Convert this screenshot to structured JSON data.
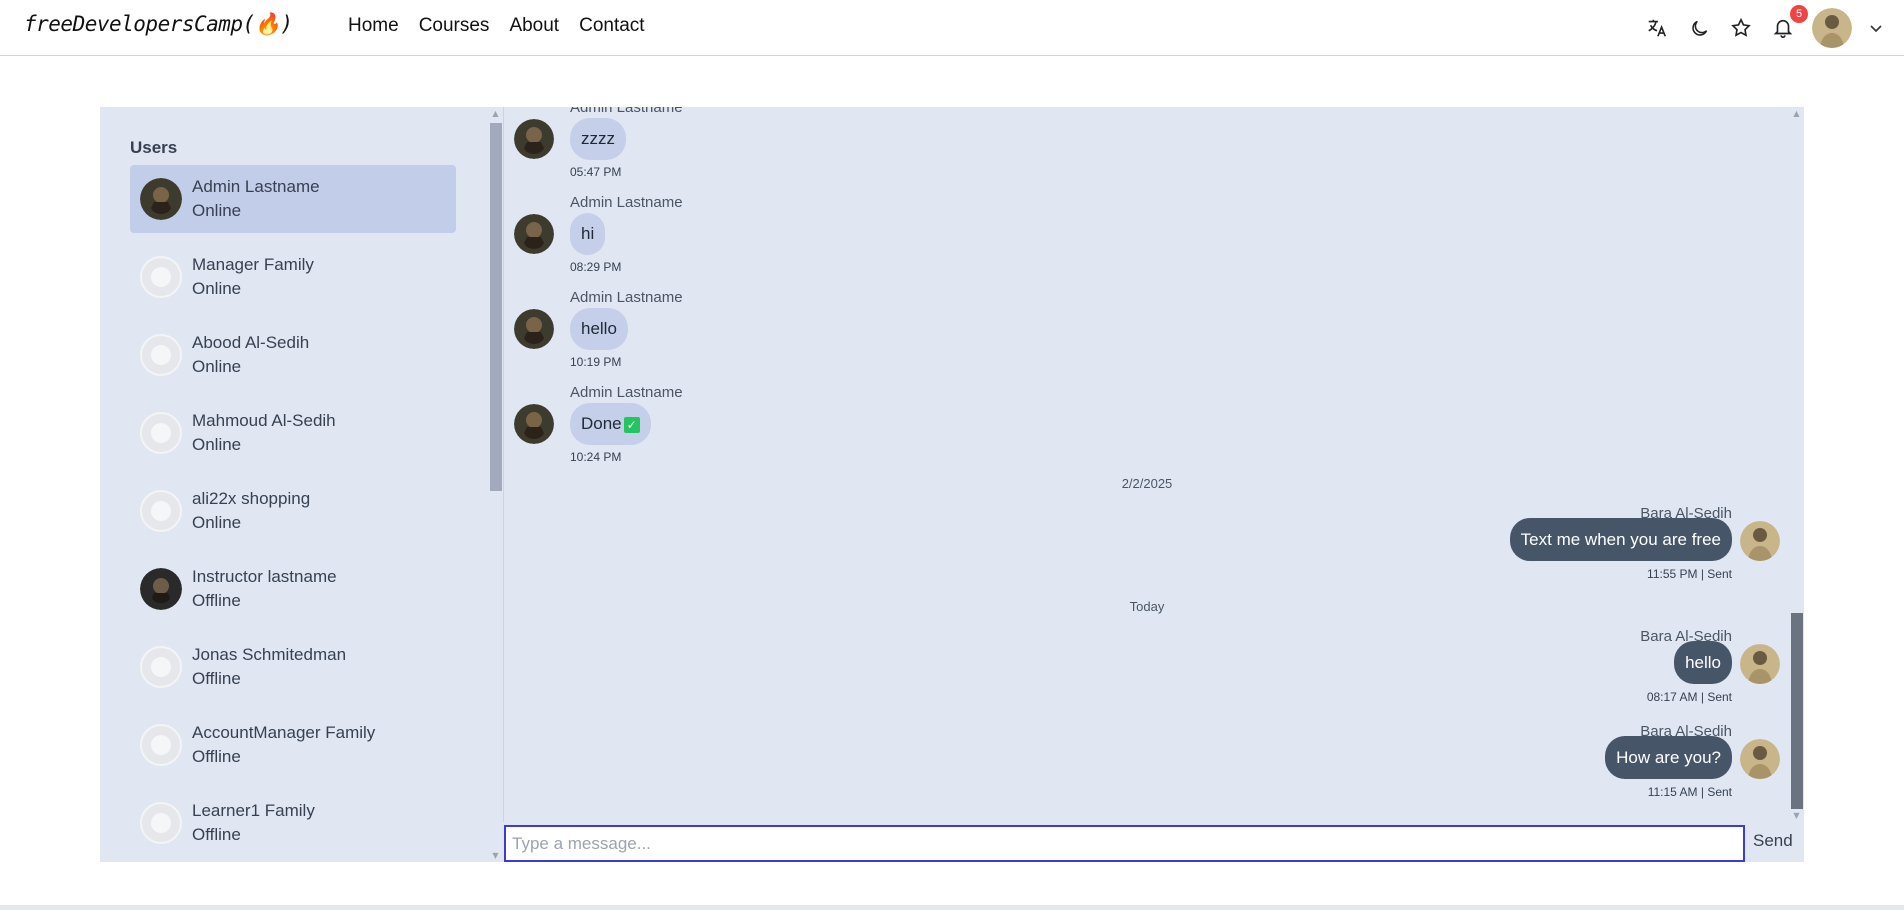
{
  "nav": {
    "logo": "freeDevelopersCamp(🔥)",
    "links": [
      "Home",
      "Courses",
      "About",
      "Contact"
    ],
    "notification_count": "5"
  },
  "sidebar": {
    "title": "Users",
    "users": [
      {
        "name": "Admin Lastname",
        "status": "Online",
        "active": true
      },
      {
        "name": "Manager Family",
        "status": "Online"
      },
      {
        "name": "Abood Al-Sedih",
        "status": "Online"
      },
      {
        "name": "Mahmoud Al-Sedih",
        "status": "Online"
      },
      {
        "name": "ali22x shopping",
        "status": "Online"
      },
      {
        "name": "Instructor lastname",
        "status": "Offline"
      },
      {
        "name": "Jonas Schmitedman",
        "status": "Offline"
      },
      {
        "name": "AccountManager Family",
        "status": "Offline"
      },
      {
        "name": "Learner1 Family",
        "status": "Offline"
      }
    ]
  },
  "messages": {
    "incoming": [
      {
        "sender": "Admin Lastname",
        "text": "zzzz",
        "time": "05:47 PM"
      },
      {
        "sender": "Admin Lastname",
        "text": "hi",
        "time": "08:29 PM"
      },
      {
        "sender": "Admin Lastname",
        "text": "hello",
        "time": "10:19 PM"
      },
      {
        "sender": "Admin Lastname",
        "text": "Done",
        "time": "10:24 PM"
      }
    ],
    "date_1": "2/2/2025",
    "date_2": "Today",
    "outgoing": [
      {
        "sender": "Bara Al-Sedih",
        "text": "Text me when you are free",
        "time": "11:55 PM  | Sent"
      },
      {
        "sender": "Bara Al-Sedih",
        "text": "hello",
        "time": "08:17 AM  | Sent"
      },
      {
        "sender": "Bara Al-Sedih",
        "text": "How are you?",
        "time": "11:15 AM  | Sent"
      }
    ]
  },
  "composer": {
    "placeholder": "Type a message...",
    "send_label": "Send"
  },
  "colors": {
    "panel_bg": "#e0e7f3",
    "active_user": "#c2cde9",
    "bubble_in": "#c5cfea",
    "bubble_out": "#475569",
    "input_border": "#3b3bd6",
    "badge": "#ef4444"
  }
}
